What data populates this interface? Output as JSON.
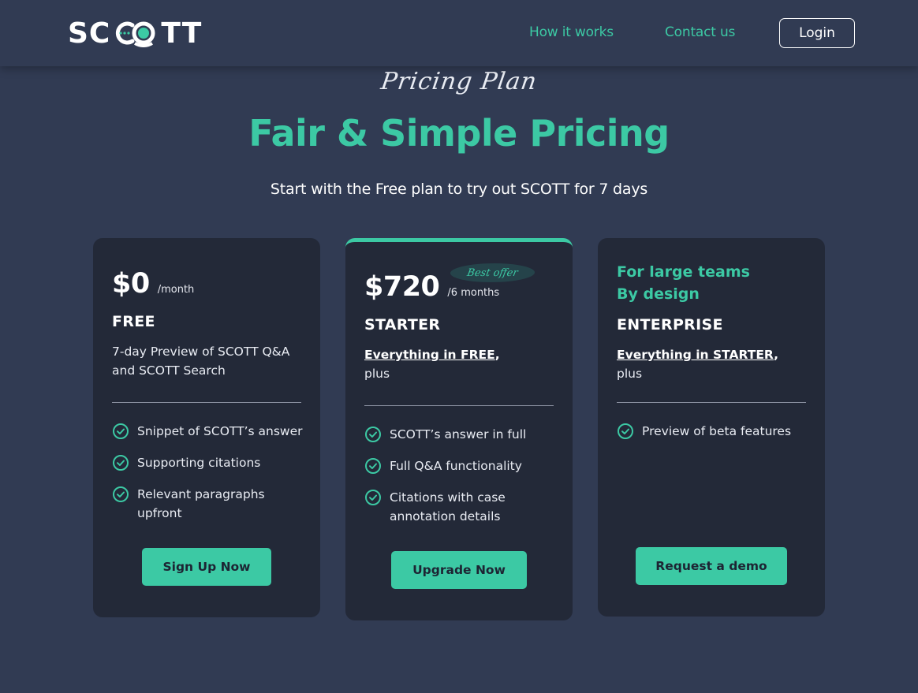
{
  "header": {
    "logo_text_left": "SC",
    "logo_text_right": "TT",
    "nav": [
      {
        "label": "How it works"
      },
      {
        "label": "Contact us"
      }
    ],
    "login_label": "Login"
  },
  "hero": {
    "script_title": "Pricing Plan",
    "headline": "Fair & Simple Pricing",
    "subhead": "Start with the Free plan to try out SCOTT for 7 days"
  },
  "colors": {
    "accent": "#3cc9a4",
    "background": "#313b53",
    "card": "#232938"
  },
  "plans": [
    {
      "price": "$0",
      "period": "/month",
      "name": "FREE",
      "description": "7-day Preview of SCOTT Q&A and SCOTT Search",
      "features": [
        "Snippet of SCOTT’s answer",
        "Supporting citations",
        "Relevant paragraphs upfront"
      ],
      "cta": "Sign Up Now"
    },
    {
      "price": "$720",
      "period": "/6 months",
      "badge": "Best offer",
      "name": "STARTER",
      "includes_link": "Everything in FREE",
      "includes_suffix": ",",
      "includes_plus": "plus",
      "features": [
        "SCOTT’s answer in full",
        "Full Q&A functionality",
        "Citations with case annotation details"
      ],
      "cta": "Upgrade Now"
    },
    {
      "tagline_line1": "For large teams",
      "tagline_line2": "By design",
      "name": "ENTERPRISE",
      "includes_link": "Everything in STARTER",
      "includes_suffix": ",",
      "includes_plus": "plus",
      "features": [
        "Preview of beta features"
      ],
      "cta": "Request a demo"
    }
  ]
}
